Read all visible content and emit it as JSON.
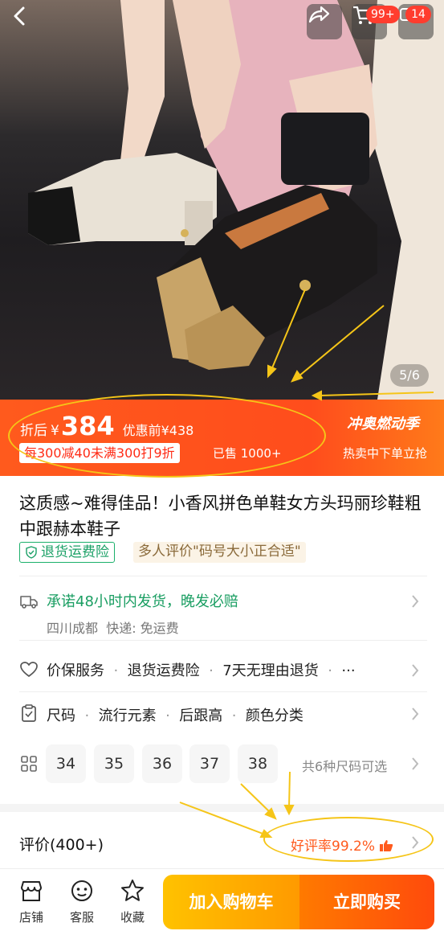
{
  "top": {
    "cart_badge": "99+",
    "message_badge": "14",
    "image_counter": "5/6"
  },
  "price_bar": {
    "after_label": "折后",
    "currency": "¥",
    "price": "384",
    "pre_discount": "优惠前¥438",
    "promo": "每300减40未满300打9折",
    "sold": "已售 1000+",
    "event_title": "冲奥燃动季",
    "event_sub": "热卖中下单立抢"
  },
  "product": {
    "title": "这质感~难得佳品！小香风拼色单鞋女方头玛丽珍鞋粗中跟赫本鞋子",
    "chip_return": "退货运费险",
    "chip_review": "多人评价\"码号大小正合适\""
  },
  "shipping": {
    "promise": "承诺48小时内发货，晚发必赔",
    "origin": "四川成都",
    "express": "快递: 免运费"
  },
  "services": {
    "items": [
      "价保服务",
      "退货运费险",
      "7天无理由退货"
    ],
    "more": "···"
  },
  "attributes": {
    "items": [
      "尺码",
      "流行元素",
      "后跟高",
      "颜色分类"
    ]
  },
  "sizes": {
    "values": [
      "34",
      "35",
      "36",
      "37",
      "38"
    ],
    "more_text": "共6种尺码可选"
  },
  "reviews": {
    "title": "评价(400+)",
    "good_rate": "好评率99.2%"
  },
  "bottom_bar": {
    "shop": "店铺",
    "service": "客服",
    "favorite": "收藏",
    "add_to_cart": "加入购物车",
    "buy_now": "立即购买"
  },
  "colors": {
    "accent_orange": "#ff5a1d",
    "green": "#1aa066",
    "annotation_yellow": "#f5c518"
  }
}
